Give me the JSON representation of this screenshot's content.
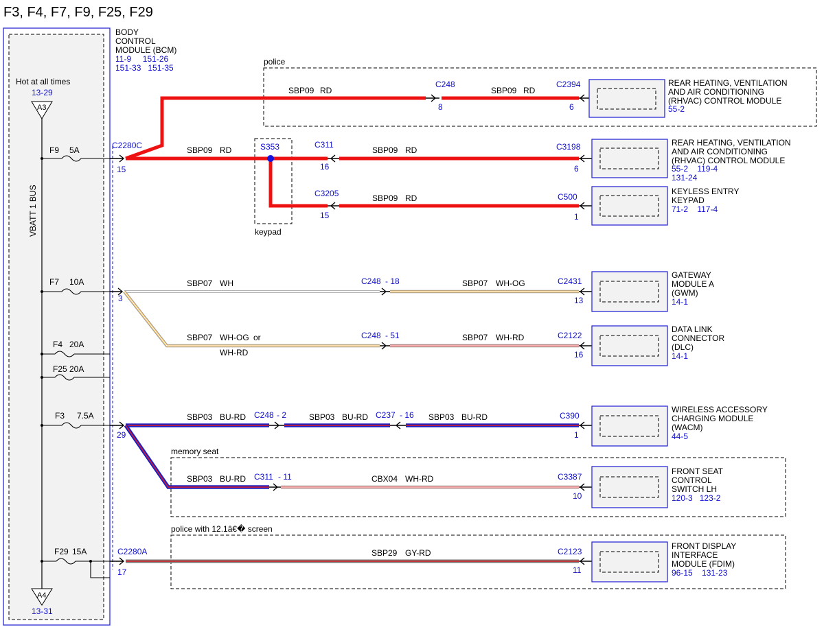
{
  "title": "F3, F4, F7, F9, F25, F29",
  "colors": {
    "red_wire": "#ee1111",
    "blue_wire": "#2020c0",
    "connector_blue": "#1010d0",
    "module_fill": "#f2f2f2"
  },
  "bus": {
    "label": "VBATT 1 BUS",
    "hot_label": "Hot at all times",
    "top_ref": "13-29",
    "top_tag": "A3",
    "bottom_tag": "A4",
    "bottom_ref": "13-31"
  },
  "bcm": {
    "lines": [
      "BODY",
      "CONTROL",
      "MODULE (BCM)"
    ],
    "refs1": "11-9     151-26",
    "refs2": "151-33   151-35"
  },
  "fuses": [
    {
      "name": "F9",
      "rating": "5A"
    },
    {
      "name": "F7",
      "rating": "10A"
    },
    {
      "name": "F4",
      "rating": "20A"
    },
    {
      "name": "F25",
      "rating": "20A"
    },
    {
      "name": "F3",
      "rating": "7.5A"
    },
    {
      "name": "F29",
      "rating": "15A"
    }
  ],
  "connectors": {
    "c2280c": "C2280C",
    "c2280c_pin": "15",
    "c2280a": "C2280A",
    "c2280a_pin": "17",
    "f7_pin": "3",
    "f3_pin": "29"
  },
  "groups": {
    "police": "police",
    "keypad": "keypad",
    "memory_seat": "memory seat",
    "police_screen": "police with 12.1â€� screen"
  },
  "wires": {
    "w1a_circuit": "SBP09",
    "w1a_color": "RD",
    "c248_a": "C248",
    "c248_a_pin": "8",
    "w1b_circuit": "SBP09",
    "w1b_color": "RD",
    "c2394": "C2394",
    "c2394_pin": "6",
    "w2a_circuit": "SBP09",
    "w2a_color": "RD",
    "s353": "S353",
    "c311_a": "C311",
    "c311_a_pin": "16",
    "w2b_circuit": "SBP09",
    "w2b_color": "RD",
    "c3198": "C3198",
    "c3198_pin": "6",
    "c3205": "C3205",
    "c3205_pin": "15",
    "w3_circuit": "SBP09",
    "w3_color": "RD",
    "c500": "C500",
    "c500_pin": "1",
    "w4a_circuit": "SBP07",
    "w4a_color": "WH",
    "c248_18": "C248",
    "c248_18_pin": "- 18",
    "w4b_circuit": "SBP07",
    "w4b_color": "WH-OG",
    "c2431": "C2431",
    "c2431_pin": "13",
    "w5a_circuit": "SBP07",
    "w5a_color": "WH-OG",
    "w5a_or": "or",
    "w5a_color2": "WH-RD",
    "c248_51": "C248",
    "c248_51_pin": "- 51",
    "w5b_circuit": "SBP07",
    "w5b_color": "WH-RD",
    "c2122": "C2122",
    "c2122_pin": "16",
    "w6a_circuit": "SBP03",
    "w6a_color": "BU-RD",
    "c248_2": "C248",
    "c248_2_pin": "- 2",
    "w6b_circuit": "SBP03",
    "w6b_color": "BU-RD",
    "c237": "C237",
    "c237_pin": "- 16",
    "w6c_circuit": "SBP03",
    "w6c_color": "BU-RD",
    "c390": "C390",
    "c390_pin": "1",
    "w7a_circuit": "SBP03",
    "w7a_color": "BU-RD",
    "c311_b": "C311",
    "c311_b_pin": "- 11",
    "w7b_circuit": "CBX04",
    "w7b_color": "WH-RD",
    "c3387": "C3387",
    "c3387_pin": "10",
    "w8_circuit": "SBP29",
    "w8_color": "GY-RD",
    "c2123": "C2123",
    "c2123_pin": "11"
  },
  "modules": [
    {
      "lines": [
        "REAR HEATING, VENTILATION",
        "AND AIR CONDITIONING",
        "(RHVAC) CONTROL MODULE"
      ],
      "refs": [
        "55-2"
      ]
    },
    {
      "lines": [
        "REAR HEATING, VENTILATION",
        "AND AIR CONDITIONING",
        "(RHVAC) CONTROL MODULE"
      ],
      "refs": [
        "55-2    119-4",
        "131-24"
      ]
    },
    {
      "lines": [
        "KEYLESS ENTRY",
        "KEYPAD"
      ],
      "refs": [
        "71-2    117-4"
      ]
    },
    {
      "lines": [
        "GATEWAY",
        "MODULE A",
        "(GWM)"
      ],
      "refs": [
        "14-1"
      ]
    },
    {
      "lines": [
        "DATA LINK",
        "CONNECTOR",
        "(DLC)"
      ],
      "refs": [
        "14-1"
      ]
    },
    {
      "lines": [
        "WIRELESS ACCESSORY",
        "CHARGING MODULE",
        "(WACM)"
      ],
      "refs": [
        "44-5"
      ]
    },
    {
      "lines": [
        "FRONT SEAT",
        "CONTROL",
        "SWITCH LH"
      ],
      "refs": [
        "120-3   123-2"
      ]
    },
    {
      "lines": [
        "FRONT DISPLAY",
        "INTERFACE",
        "MODULE (FDIM)"
      ],
      "refs": [
        "96-15    131-23"
      ]
    }
  ]
}
